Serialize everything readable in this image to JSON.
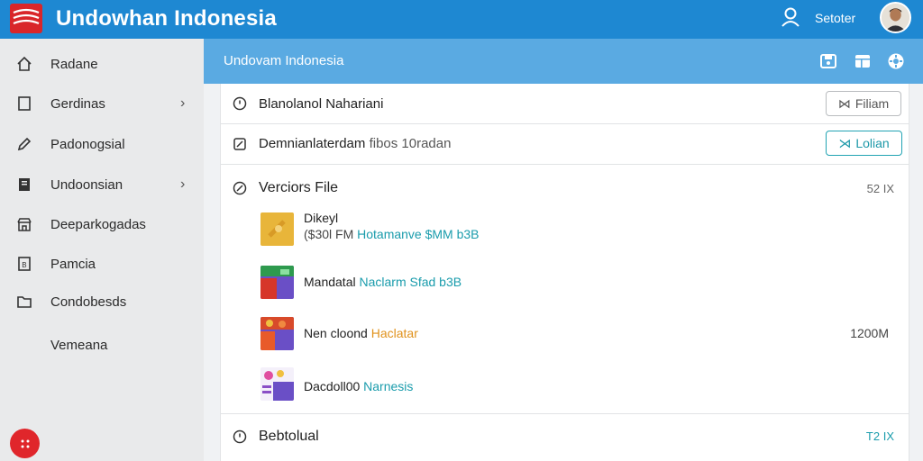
{
  "app": {
    "title": "Undowhan Indonesia"
  },
  "topbar": {
    "user_name": "Setoter"
  },
  "sidebar": {
    "items": [
      {
        "label": "Radane"
      },
      {
        "label": "Gerdinas"
      },
      {
        "label": "Padonogsial"
      },
      {
        "label": "Undoonsian"
      },
      {
        "label": "Deeparkogadas"
      },
      {
        "label": "Pamcia"
      },
      {
        "label": "Condobesds"
      },
      {
        "label": "Vemeana"
      }
    ]
  },
  "main": {
    "title": "Undovam Indonesia",
    "row1": {
      "label": "Blanolanol Nahariani",
      "button": "Filiam"
    },
    "row2": {
      "label": "Demnianlaterdam",
      "label_extra": "fibos 10radan",
      "button": "Lolian"
    },
    "section1": {
      "title": "Verciors File",
      "right": "52 IX",
      "files": [
        {
          "name": "Dikeyl",
          "meta_prefix": "($30l FM",
          "meta_highlight": "Hotamanve $MM b3B",
          "size": "",
          "colors": [
            "#e8b53a",
            "#d89a26"
          ]
        },
        {
          "name": "Mandatal",
          "meta_prefix": "",
          "meta_highlight": "Naclarm Sfad b3B",
          "size": "",
          "colors": [
            "#2e9a4e",
            "#6a4fc6",
            "#d6362a"
          ]
        },
        {
          "name": "Nen cloond",
          "meta_prefix": "",
          "meta_highlight": "Haclatar",
          "size": "1200M",
          "colors": [
            "#d84a2a",
            "#6a4fc6",
            "#f0c040"
          ]
        },
        {
          "name": "Dacdoll00",
          "meta_prefix": "",
          "meta_highlight": "Narnesis",
          "size": "",
          "colors": [
            "#8a4fc6",
            "#e04fa0",
            "#6a4fc6"
          ]
        }
      ]
    },
    "section2": {
      "title": "Bebtolual",
      "right": "T2 IX"
    }
  }
}
